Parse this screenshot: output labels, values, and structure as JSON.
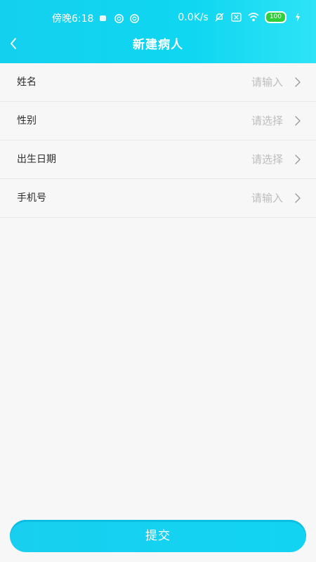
{
  "status_bar": {
    "time": "傍晚6:18",
    "network_speed": "0.0K/s",
    "battery_level": "100",
    "icons": [
      "notification-icon",
      "sync-icon",
      "sync-icon",
      "mute-icon",
      "sim-icon",
      "wifi-icon",
      "battery-icon",
      "charging-icon"
    ]
  },
  "header": {
    "title": "新建病人",
    "back_icon": "chevron-left-icon"
  },
  "form": {
    "rows": [
      {
        "label": "姓名",
        "placeholder": "请输入"
      },
      {
        "label": "性别",
        "placeholder": "请选择"
      },
      {
        "label": "出生日期",
        "placeholder": "请选择"
      },
      {
        "label": "手机号",
        "placeholder": "请输入"
      }
    ]
  },
  "submit": {
    "label": "提交"
  },
  "colors": {
    "primary": "#14d0ef",
    "placeholder": "#bdbdbd",
    "label": "#2d2d2d",
    "background": "#f7f7f7"
  }
}
